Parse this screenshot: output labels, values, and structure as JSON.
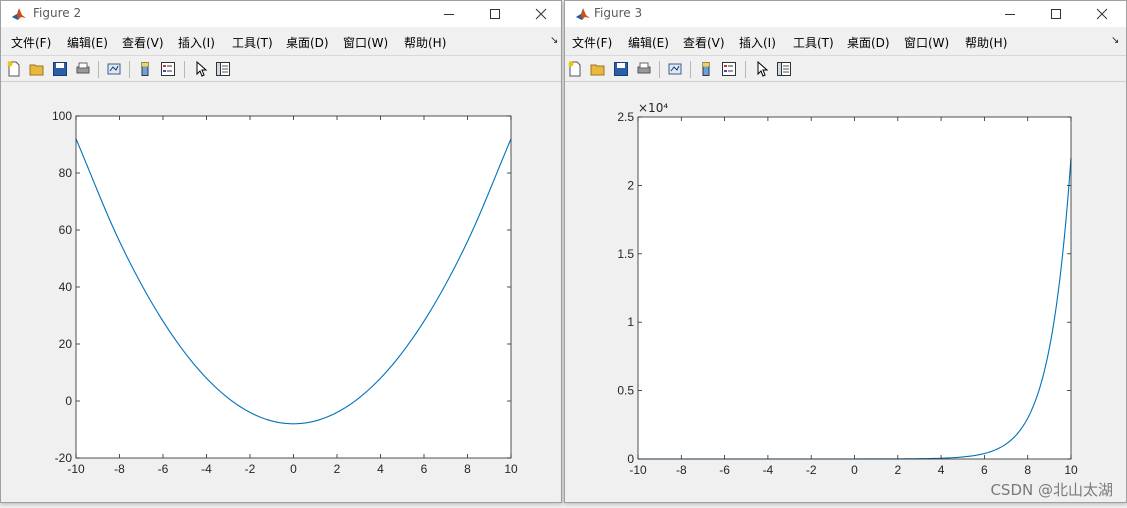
{
  "desktop": {
    "watermark": "CSDN @北山太湖"
  },
  "menu_labels": [
    "文件(F)",
    "编辑(E)",
    "查看(V)",
    "插入(I)",
    "工具(T)",
    "桌面(D)",
    "窗口(W)",
    "帮助(H)"
  ],
  "windows": [
    {
      "title": "Figure 2",
      "chart_data": {
        "type": "line",
        "x_range": [
          -10,
          10
        ],
        "xlim": [
          -10,
          10
        ],
        "ylim": [
          -20,
          100
        ],
        "xticks": [
          -10,
          -8,
          -6,
          -4,
          -2,
          0,
          2,
          4,
          6,
          8,
          10
        ],
        "yticks": [
          -20,
          0,
          20,
          40,
          60,
          80,
          100
        ],
        "ytick_labels": [
          "-20",
          "0",
          "20",
          "40",
          "60",
          "80",
          "100"
        ],
        "exponent_label": "",
        "series": [
          {
            "color": "#0072bd",
            "x": [
              -10,
              -8,
              -6,
              -4,
              -2,
              0,
              2,
              4,
              6,
              8,
              10
            ],
            "y": [
              92,
              56,
              28,
              8,
              -4,
              -8,
              -4,
              8,
              28,
              56,
              92
            ]
          }
        ],
        "grid": false
      }
    },
    {
      "title": "Figure 3",
      "chart_data": {
        "type": "line",
        "x_range": [
          -10,
          10
        ],
        "xlim": [
          -10,
          10
        ],
        "ylim": [
          0,
          25000
        ],
        "xticks": [
          -10,
          -8,
          -6,
          -4,
          -2,
          0,
          2,
          4,
          6,
          8,
          10
        ],
        "yticks": [
          0,
          5000,
          10000,
          15000,
          20000,
          25000
        ],
        "ytick_labels": [
          "0",
          "0.5",
          "1",
          "1.5",
          "2",
          "2.5"
        ],
        "exponent_label": "×10⁴",
        "series": [
          {
            "color": "#0072bd",
            "x": [
              -10,
              -8,
              -6,
              -4,
              -2,
              0,
              2,
              4,
              6,
              7,
              8,
              9,
              10
            ],
            "y": [
              0,
              0,
              0,
              0,
              0,
              1,
              7,
              55,
              403,
              1097,
              2981,
              8103,
              22026
            ]
          }
        ],
        "grid": false
      }
    }
  ]
}
